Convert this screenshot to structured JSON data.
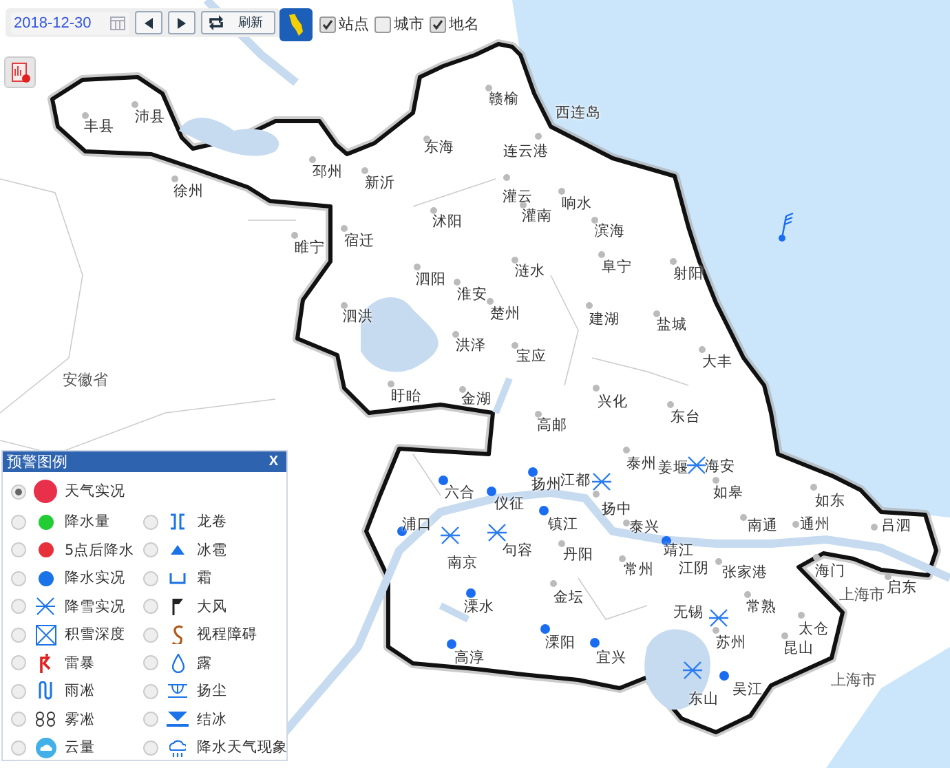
{
  "toolbar": {
    "date": "2018-12-30",
    "refresh": "刷新",
    "layers": [
      {
        "label": "站点",
        "checked": true
      },
      {
        "label": "城市",
        "checked": false
      },
      {
        "label": "地名",
        "checked": true
      }
    ]
  },
  "places": [
    {
      "name": "丰县",
      "kind": "station"
    },
    {
      "name": "沛县",
      "kind": "station"
    },
    {
      "name": "赣榆",
      "kind": "station"
    },
    {
      "name": "西连岛",
      "kind": "none"
    },
    {
      "name": "东海",
      "kind": "station"
    },
    {
      "name": "连云港",
      "kind": "station"
    },
    {
      "name": "徐州",
      "kind": "station"
    },
    {
      "name": "邳州",
      "kind": "station"
    },
    {
      "name": "新沂",
      "kind": "station"
    },
    {
      "name": "灌云",
      "kind": "station"
    },
    {
      "name": "响水",
      "kind": "station"
    },
    {
      "name": "睢宁",
      "kind": "station"
    },
    {
      "name": "宿迁",
      "kind": "station"
    },
    {
      "name": "沭阳",
      "kind": "station"
    },
    {
      "name": "灌南",
      "kind": "station"
    },
    {
      "name": "滨海",
      "kind": "station"
    },
    {
      "name": "泗阳",
      "kind": "station"
    },
    {
      "name": "涟水",
      "kind": "station"
    },
    {
      "name": "阜宁",
      "kind": "station"
    },
    {
      "name": "射阳",
      "kind": "station"
    },
    {
      "name": "淮安",
      "kind": "station"
    },
    {
      "name": "泗洪",
      "kind": "station"
    },
    {
      "name": "楚州",
      "kind": "station"
    },
    {
      "name": "建湖",
      "kind": "station"
    },
    {
      "name": "盐城",
      "kind": "station"
    },
    {
      "name": "洪泽",
      "kind": "station"
    },
    {
      "name": "宝应",
      "kind": "station"
    },
    {
      "name": "大丰",
      "kind": "station"
    },
    {
      "name": "安徽省",
      "kind": "region"
    },
    {
      "name": "盱眙",
      "kind": "station"
    },
    {
      "name": "金湖",
      "kind": "station"
    },
    {
      "name": "高邮",
      "kind": "station"
    },
    {
      "name": "兴化",
      "kind": "station"
    },
    {
      "name": "东台",
      "kind": "station"
    },
    {
      "name": "六合",
      "kind": "rain"
    },
    {
      "name": "仪征",
      "kind": "rain"
    },
    {
      "name": "扬州",
      "kind": "rain"
    },
    {
      "name": "江都",
      "kind": "snow"
    },
    {
      "name": "扬中",
      "kind": "station"
    },
    {
      "name": "泰州",
      "kind": "station"
    },
    {
      "name": "姜堰",
      "kind": "none"
    },
    {
      "name": "海安",
      "kind": "snow"
    },
    {
      "name": "如皋",
      "kind": "station"
    },
    {
      "name": "如东",
      "kind": "station"
    },
    {
      "name": "浦口",
      "kind": "rain"
    },
    {
      "name": "镇江",
      "kind": "rain"
    },
    {
      "name": "泰兴",
      "kind": "station"
    },
    {
      "name": "南通",
      "kind": "station"
    },
    {
      "name": "通州",
      "kind": "station"
    },
    {
      "name": "吕泗",
      "kind": "station"
    },
    {
      "name": "南京",
      "kind": "snow"
    },
    {
      "name": "句容",
      "kind": "snow"
    },
    {
      "name": "丹阳",
      "kind": "station"
    },
    {
      "name": "常州",
      "kind": "station"
    },
    {
      "name": "靖江",
      "kind": "rain"
    },
    {
      "name": "江阴",
      "kind": "none"
    },
    {
      "name": "张家港",
      "kind": "station"
    },
    {
      "name": "海门",
      "kind": "station"
    },
    {
      "name": "溧水",
      "kind": "rain"
    },
    {
      "name": "金坛",
      "kind": "station"
    },
    {
      "name": "无锡",
      "kind": "snow"
    },
    {
      "name": "常熟",
      "kind": "station"
    },
    {
      "name": "上海市",
      "kind": "region"
    },
    {
      "name": "启东",
      "kind": "station"
    },
    {
      "name": "高淳",
      "kind": "rain"
    },
    {
      "name": "溧阳",
      "kind": "rain"
    },
    {
      "name": "宜兴",
      "kind": "rain"
    },
    {
      "name": "苏州",
      "kind": "station"
    },
    {
      "name": "昆山",
      "kind": "station"
    },
    {
      "name": "太仓",
      "kind": "station"
    },
    {
      "name": "东山",
      "kind": "snow"
    },
    {
      "name": "吴江",
      "kind": "rain"
    },
    {
      "name": "上海市",
      "kind": "region"
    }
  ],
  "legend": {
    "title": "预警图例",
    "close": "X",
    "items": [
      {
        "label": "天气实况",
        "selected": true,
        "kind": "live"
      },
      {
        "label": "降水量",
        "selected": false,
        "kind": "dot",
        "color": "#22cc33"
      },
      {
        "label": "龙卷",
        "selected": false,
        "kind": "tornado"
      },
      {
        "label": "5点后降水",
        "selected": false,
        "kind": "dot",
        "color": "#e8303a"
      },
      {
        "label": "冰雹",
        "selected": false,
        "kind": "hail"
      },
      {
        "label": "降水实况",
        "selected": false,
        "kind": "dot",
        "color": "#1a73e8"
      },
      {
        "label": "霜",
        "selected": false,
        "kind": "frost"
      },
      {
        "label": "降雪实况",
        "selected": false,
        "kind": "snow"
      },
      {
        "label": "大风",
        "selected": false,
        "kind": "wind"
      },
      {
        "label": "积雪深度",
        "selected": false,
        "kind": "snowdepth"
      },
      {
        "label": "视程障碍",
        "selected": false,
        "kind": "visibility"
      },
      {
        "label": "雷暴",
        "selected": false,
        "kind": "thunder"
      },
      {
        "label": "露",
        "selected": false,
        "kind": "dew"
      },
      {
        "label": "雨凇",
        "selected": false,
        "kind": "glaze"
      },
      {
        "label": "扬尘",
        "selected": false,
        "kind": "dust"
      },
      {
        "label": "雾凇",
        "selected": false,
        "kind": "rime"
      },
      {
        "label": "结冰",
        "selected": false,
        "kind": "icing"
      },
      {
        "label": "云量",
        "selected": false,
        "kind": "cloud"
      },
      {
        "label": "降水天气现象",
        "selected": false,
        "kind": "precip"
      }
    ]
  }
}
